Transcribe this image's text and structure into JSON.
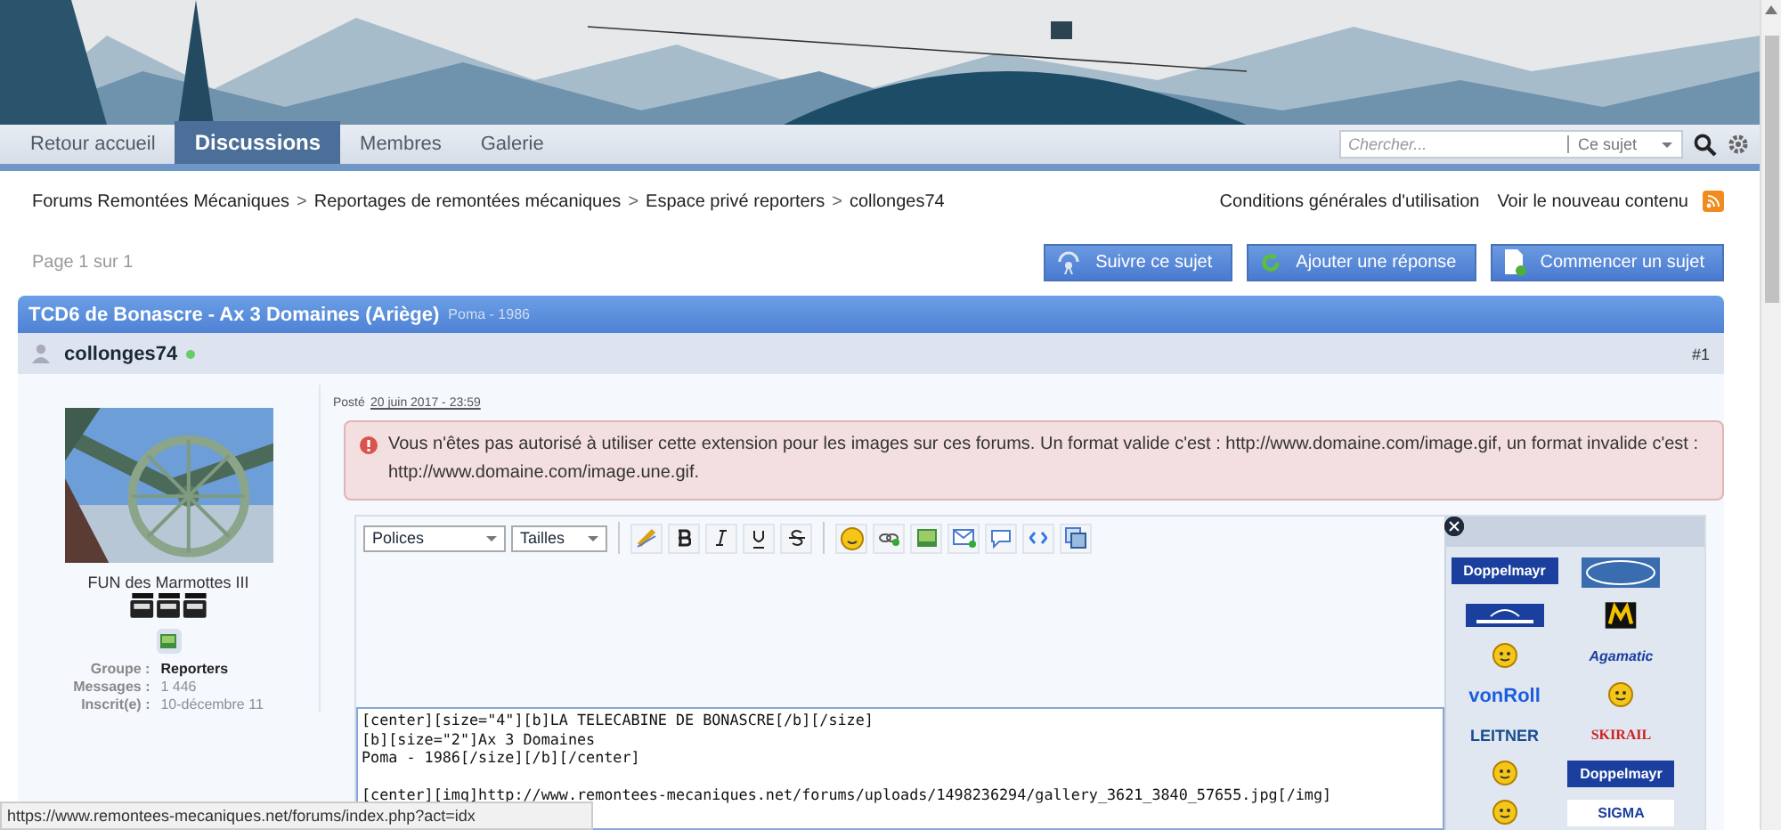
{
  "nav": {
    "tabs": [
      {
        "label": "Retour accueil",
        "selected": false
      },
      {
        "label": "Discussions",
        "selected": true
      },
      {
        "label": "Membres",
        "selected": false
      },
      {
        "label": "Galerie",
        "selected": false
      }
    ],
    "search": {
      "placeholder": "Chercher...",
      "scope": "Ce sujet"
    }
  },
  "breadcrumbs": [
    {
      "label": "Forums Remontées Mécaniques"
    },
    {
      "separator": ">",
      "label": "Reportages de remontées mécaniques"
    },
    {
      "separator": ">",
      "label": "Espace privé reporters"
    },
    {
      "separator": ">",
      "label": "collonges74"
    }
  ],
  "header_links": [
    "Conditions générales d'utilisation",
    "Voir le nouveau contenu"
  ],
  "pagination": "Page 1 sur 1",
  "actions": [
    {
      "label": "Suivre ce sujet",
      "kind": "follow"
    },
    {
      "label": "Ajouter une réponse",
      "kind": "reply"
    },
    {
      "label": "Commencer un sujet",
      "kind": "new"
    }
  ],
  "topic": {
    "title": "TCD6 de Bonascre - Ax 3 Domaines (Ariège)",
    "description": "Poma - 1986"
  },
  "post": {
    "author": "collonges74",
    "number": "#1",
    "author_title": "FUN des Marmottes III",
    "posted_label": "Posté",
    "posted_date": "20 juin 2017 - 23:59",
    "fields": [
      {
        "label": "Groupe :",
        "value": "Reporters",
        "kind": "strong"
      },
      {
        "label": "Messages :",
        "value": "1 446",
        "kind": "muted"
      },
      {
        "label": "Inscrit(e) :",
        "value": "10-décembre 11",
        "kind": "muted"
      }
    ]
  },
  "error": "Vous n'êtes pas autorisé à utiliser cette extension pour les images sur ces forums. Un format valide c'est : http://www.domaine.com/image.gif, un format invalide c'est : http://www.domaine.com/image.une.gif.",
  "editor": {
    "font_select": "Polices",
    "size_select": "Tailles",
    "text_paragraphs": [
      [
        "[center][size=\"4\"][b]LA TELECABINE DE BONASCRE[/b][/size]",
        "[b][size=\"2\"]Ax 3 Domaines",
        "Poma - 1986[/size][/b][/center]"
      ],
      [
        "[center][img]http://www.remontees-mecaniques.net/forums/uploads/1498236294/gallery_3621_3840_57655.jpg[/img]"
      ]
    ]
  },
  "emoticons": [
    {
      "kind": "logo",
      "label": "Doppelmayr"
    },
    {
      "kind": "mark"
    },
    {
      "kind": "mark"
    },
    {
      "kind": "mark"
    },
    {
      "kind": "smiley"
    },
    {
      "kind": "logo",
      "label": "Agamatic"
    },
    {
      "kind": "logo",
      "label": "vonRoll"
    },
    {
      "kind": "smiley"
    },
    {
      "kind": "logo",
      "label": "LEITNER"
    },
    {
      "kind": "logo",
      "label": "SKIRAIL"
    },
    {
      "kind": "smiley"
    },
    {
      "kind": "logo",
      "label": "Doppelmayr"
    },
    {
      "kind": "smiley"
    },
    {
      "kind": "logo",
      "label": "SIGMA"
    }
  ],
  "status_url": "https://www.remontees-mecaniques.net/forums/index.php?act=idx"
}
